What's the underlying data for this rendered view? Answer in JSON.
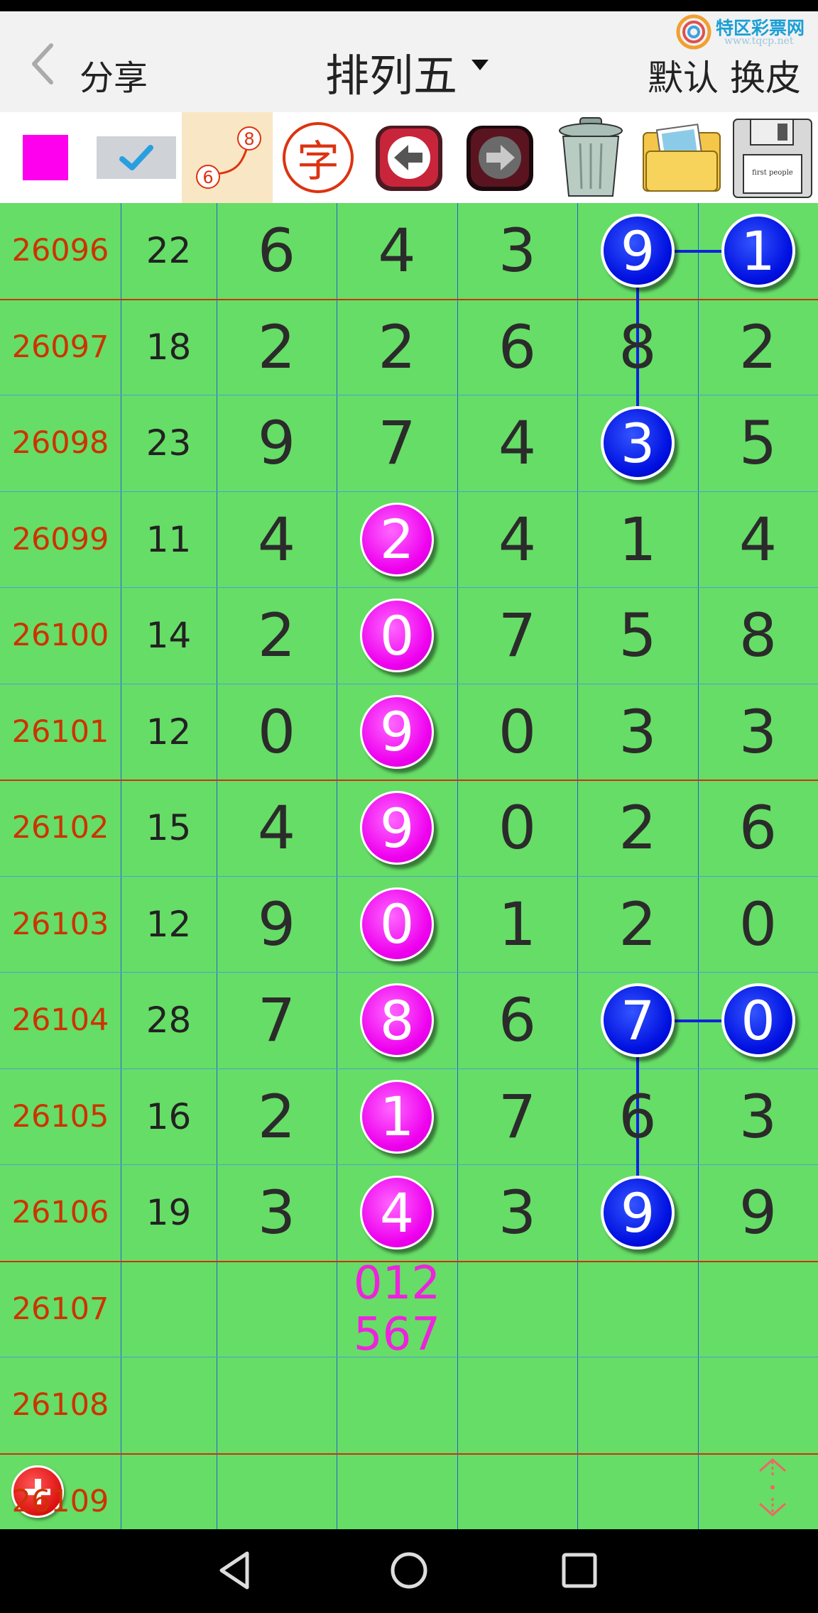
{
  "header": {
    "back_label": "分享",
    "title": "排列五",
    "default_label": "默认",
    "skin_label": "换皮",
    "logo_text": "特区彩票网",
    "logo_url": "www.tqcp.net"
  },
  "toolbar": {
    "items": [
      {
        "name": "color-swatch-magenta",
        "color": "#ff00ee"
      },
      {
        "name": "checkmark-button"
      },
      {
        "name": "connect-line-tool",
        "top_digit": "8",
        "bottom_digit": "6"
      },
      {
        "name": "text-tool",
        "glyph": "字"
      },
      {
        "name": "undo-arrow-button"
      },
      {
        "name": "redo-arrow-button"
      },
      {
        "name": "trash-can-button"
      },
      {
        "name": "photo-folder-button"
      },
      {
        "name": "save-disk-button",
        "label": "first people"
      }
    ]
  },
  "colors": {
    "grid_background": "#66dd66",
    "issue_text": "#cc3300",
    "highlight_magenta": "#ee00ee",
    "highlight_blue": "#0010e0",
    "prediction_text": "#ee22dd"
  },
  "rows": [
    {
      "issue": "26096",
      "sum": "22",
      "digits": [
        "6",
        "4",
        "3",
        "9",
        "1"
      ]
    },
    {
      "issue": "26097",
      "sum": "18",
      "digits": [
        "2",
        "2",
        "6",
        "8",
        "2"
      ]
    },
    {
      "issue": "26098",
      "sum": "23",
      "digits": [
        "9",
        "7",
        "4",
        "3",
        "5"
      ]
    },
    {
      "issue": "26099",
      "sum": "11",
      "digits": [
        "4",
        "2",
        "4",
        "1",
        "4"
      ]
    },
    {
      "issue": "26100",
      "sum": "14",
      "digits": [
        "2",
        "0",
        "7",
        "5",
        "8"
      ]
    },
    {
      "issue": "26101",
      "sum": "12",
      "digits": [
        "0",
        "9",
        "0",
        "3",
        "3"
      ]
    },
    {
      "issue": "26102",
      "sum": "15",
      "digits": [
        "4",
        "9",
        "0",
        "2",
        "6"
      ]
    },
    {
      "issue": "26103",
      "sum": "12",
      "digits": [
        "9",
        "0",
        "1",
        "2",
        "0"
      ]
    },
    {
      "issue": "26104",
      "sum": "28",
      "digits": [
        "7",
        "8",
        "6",
        "7",
        "0"
      ]
    },
    {
      "issue": "26105",
      "sum": "16",
      "digits": [
        "2",
        "1",
        "7",
        "6",
        "3"
      ]
    },
    {
      "issue": "26106",
      "sum": "19",
      "digits": [
        "3",
        "4",
        "3",
        "9",
        "9"
      ]
    },
    {
      "issue": "26107",
      "sum": "",
      "digits": [
        "",
        "",
        "",
        "",
        ""
      ]
    },
    {
      "issue": "26108",
      "sum": "",
      "digits": [
        "",
        "",
        "",
        "",
        ""
      ]
    },
    {
      "issue": "26109",
      "sum": "",
      "digits": [
        "",
        "",
        "",
        "",
        ""
      ]
    }
  ],
  "highlights": {
    "magenta": [
      [
        3,
        1
      ],
      [
        4,
        1
      ],
      [
        5,
        1
      ],
      [
        6,
        1
      ],
      [
        7,
        1
      ],
      [
        8,
        1
      ],
      [
        9,
        1
      ],
      [
        10,
        1
      ]
    ],
    "blue": [
      [
        0,
        3
      ],
      [
        0,
        4
      ],
      [
        2,
        3
      ],
      [
        8,
        3
      ],
      [
        8,
        4
      ],
      [
        10,
        3
      ]
    ]
  },
  "prediction": {
    "row": 11,
    "col": 1,
    "line1": "012",
    "line2": "567"
  },
  "fab": {
    "name": "add-button"
  },
  "nav": [
    "back",
    "home",
    "recents"
  ]
}
